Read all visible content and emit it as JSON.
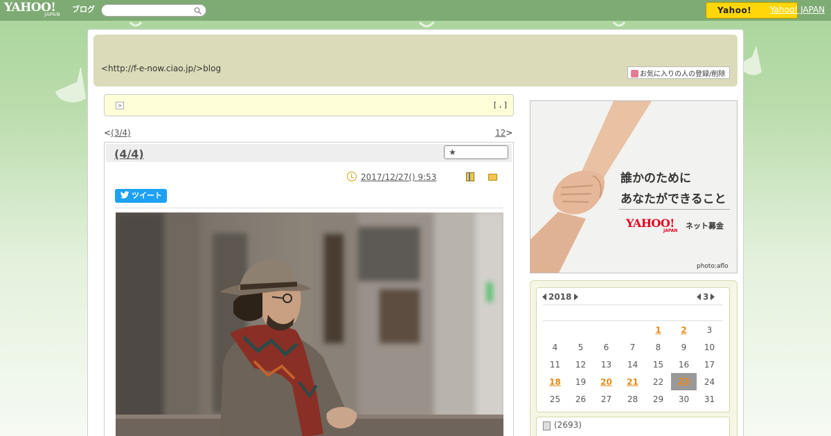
{
  "topbar": {
    "logo_main": "YAHOO!",
    "logo_sub": "JAPAN",
    "logo_service": "ブログ",
    "search_placeholder": "",
    "yahoo_button_label": "Yahoo!",
    "yahoo_japan_link": "Yahoo! JAPAN"
  },
  "header": {
    "blog_url": "<http://f-e-now.ciao.jp/>blog",
    "favorite_button": "お気に入りの人の登録/削除"
  },
  "notice": {
    "arrow": ">",
    "bracket": "[ , ]"
  },
  "nav": {
    "prev_prefix": "<",
    "prev_label": "(3/4)",
    "next_label": "12",
    "next_suffix": ">"
  },
  "article": {
    "title": "(4/4)",
    "star_label": "★",
    "date": "2017/12/27()  9:53",
    "tweet_label": "ツイート"
  },
  "ad": {
    "line1": "誰かのために",
    "line2": "あなたができること",
    "brand": "YAHOO!",
    "brand_sub": "JAPAN",
    "service": "ネット募金",
    "credit": "photo:aflo"
  },
  "calendar": {
    "year": "2018",
    "month": "3",
    "rows": [
      [
        "",
        "",
        "",
        "",
        "1",
        "2",
        "3"
      ],
      [
        "4",
        "5",
        "6",
        "7",
        "8",
        "9",
        "10"
      ],
      [
        "11",
        "12",
        "13",
        "14",
        "15",
        "16",
        "17"
      ],
      [
        "18",
        "19",
        "20",
        "21",
        "22",
        "23",
        "24"
      ],
      [
        "25",
        "26",
        "27",
        "28",
        "29",
        "30",
        "31"
      ]
    ],
    "highlighted": [
      "1",
      "2",
      "18",
      "20",
      "21",
      "23"
    ],
    "today": "23"
  },
  "stats": {
    "count": "(2693)"
  }
}
